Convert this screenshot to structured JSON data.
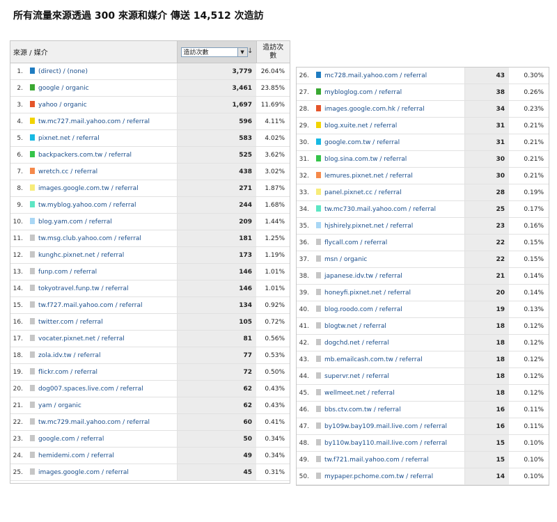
{
  "title": "所有流量來源透過 300 來源和媒介 傳送 14,512 次造訪",
  "table_header": {
    "source": "來源 / 媒介",
    "metric_select": "造訪次數",
    "metric_col": "造訪次數",
    "sort_icon": "sort-descending-icon",
    "dropdown_icon": "dropdown-arrow-icon"
  },
  "left_rows": [
    {
      "n": "1.",
      "src": "(direct) / (none)",
      "visits": "3,779",
      "pct": "26.04%",
      "color": "#1f7cc1"
    },
    {
      "n": "2.",
      "src": "google / organic",
      "visits": "3,461",
      "pct": "23.85%",
      "color": "#3aa832"
    },
    {
      "n": "3.",
      "src": "yahoo / organic",
      "visits": "1,697",
      "pct": "11.69%",
      "color": "#e4552b"
    },
    {
      "n": "4.",
      "src": "tw.mc727.mail.yahoo.com / referral",
      "visits": "596",
      "pct": "4.11%",
      "color": "#f2d400"
    },
    {
      "n": "5.",
      "src": "pixnet.net / referral",
      "visits": "583",
      "pct": "4.02%",
      "color": "#17b9e3"
    },
    {
      "n": "6.",
      "src": "backpackers.com.tw / referral",
      "visits": "525",
      "pct": "3.62%",
      "color": "#35c44a"
    },
    {
      "n": "7.",
      "src": "wretch.cc / referral",
      "visits": "438",
      "pct": "3.02%",
      "color": "#f5894a"
    },
    {
      "n": "8.",
      "src": "images.google.com.tw / referral",
      "visits": "271",
      "pct": "1.87%",
      "color": "#f7ec7a"
    },
    {
      "n": "9.",
      "src": "tw.myblog.yahoo.com / referral",
      "visits": "244",
      "pct": "1.68%",
      "color": "#5de6c4"
    },
    {
      "n": "10.",
      "src": "blog.yam.com / referral",
      "visits": "209",
      "pct": "1.44%",
      "color": "#a9d7f5"
    },
    {
      "n": "11.",
      "src": "tw.msg.club.yahoo.com / referral",
      "visits": "181",
      "pct": "1.25%",
      "color": "#c6c6c6"
    },
    {
      "n": "12.",
      "src": "kunghc.pixnet.net / referral",
      "visits": "173",
      "pct": "1.19%",
      "color": "#c6c6c6"
    },
    {
      "n": "13.",
      "src": "funp.com / referral",
      "visits": "146",
      "pct": "1.01%",
      "color": "#c6c6c6"
    },
    {
      "n": "14.",
      "src": "tokyotravel.funp.tw / referral",
      "visits": "146",
      "pct": "1.01%",
      "color": "#c6c6c6"
    },
    {
      "n": "15.",
      "src": "tw.f727.mail.yahoo.com / referral",
      "visits": "134",
      "pct": "0.92%",
      "color": "#c6c6c6"
    },
    {
      "n": "16.",
      "src": "twitter.com / referral",
      "visits": "105",
      "pct": "0.72%",
      "color": "#c6c6c6"
    },
    {
      "n": "17.",
      "src": "vocater.pixnet.net / referral",
      "visits": "81",
      "pct": "0.56%",
      "color": "#c6c6c6"
    },
    {
      "n": "18.",
      "src": "zola.idv.tw / referral",
      "visits": "77",
      "pct": "0.53%",
      "color": "#c6c6c6"
    },
    {
      "n": "19.",
      "src": "flickr.com / referral",
      "visits": "72",
      "pct": "0.50%",
      "color": "#c6c6c6"
    },
    {
      "n": "20.",
      "src": "dog007.spaces.live.com / referral",
      "visits": "62",
      "pct": "0.43%",
      "color": "#c6c6c6"
    },
    {
      "n": "21.",
      "src": "yam / organic",
      "visits": "62",
      "pct": "0.43%",
      "color": "#c6c6c6"
    },
    {
      "n": "22.",
      "src": "tw.mc729.mail.yahoo.com / referral",
      "visits": "60",
      "pct": "0.41%",
      "color": "#c6c6c6"
    },
    {
      "n": "23.",
      "src": "google.com / referral",
      "visits": "50",
      "pct": "0.34%",
      "color": "#c6c6c6"
    },
    {
      "n": "24.",
      "src": "hemidemi.com / referral",
      "visits": "49",
      "pct": "0.34%",
      "color": "#c6c6c6"
    },
    {
      "n": "25.",
      "src": "images.google.com / referral",
      "visits": "45",
      "pct": "0.31%",
      "color": "#c6c6c6"
    }
  ],
  "right_rows": [
    {
      "n": "26.",
      "src": "mc728.mail.yahoo.com / referral",
      "visits": "43",
      "pct": "0.30%",
      "color": "#1f7cc1"
    },
    {
      "n": "27.",
      "src": "mybloglog.com / referral",
      "visits": "38",
      "pct": "0.26%",
      "color": "#3aa832"
    },
    {
      "n": "28.",
      "src": "images.google.com.hk / referral",
      "visits": "34",
      "pct": "0.23%",
      "color": "#e4552b"
    },
    {
      "n": "29.",
      "src": "blog.xuite.net / referral",
      "visits": "31",
      "pct": "0.21%",
      "color": "#f2d400"
    },
    {
      "n": "30.",
      "src": "google.com.tw / referral",
      "visits": "31",
      "pct": "0.21%",
      "color": "#17b9e3"
    },
    {
      "n": "31.",
      "src": "blog.sina.com.tw / referral",
      "visits": "30",
      "pct": "0.21%",
      "color": "#35c44a"
    },
    {
      "n": "32.",
      "src": "lemures.pixnet.net / referral",
      "visits": "30",
      "pct": "0.21%",
      "color": "#f5894a"
    },
    {
      "n": "33.",
      "src": "panel.pixnet.cc / referral",
      "visits": "28",
      "pct": "0.19%",
      "color": "#f7ec7a"
    },
    {
      "n": "34.",
      "src": "tw.mc730.mail.yahoo.com / referral",
      "visits": "25",
      "pct": "0.17%",
      "color": "#5de6c4"
    },
    {
      "n": "35.",
      "src": "hjshirely.pixnet.net / referral",
      "visits": "23",
      "pct": "0.16%",
      "color": "#a9d7f5"
    },
    {
      "n": "36.",
      "src": "flycall.com / referral",
      "visits": "22",
      "pct": "0.15%",
      "color": "#c6c6c6"
    },
    {
      "n": "37.",
      "src": "msn / organic",
      "visits": "22",
      "pct": "0.15%",
      "color": "#c6c6c6"
    },
    {
      "n": "38.",
      "src": "japanese.idv.tw / referral",
      "visits": "21",
      "pct": "0.14%",
      "color": "#c6c6c6"
    },
    {
      "n": "39.",
      "src": "honeyfi.pixnet.net / referral",
      "visits": "20",
      "pct": "0.14%",
      "color": "#c6c6c6"
    },
    {
      "n": "40.",
      "src": "blog.roodo.com / referral",
      "visits": "19",
      "pct": "0.13%",
      "color": "#c6c6c6"
    },
    {
      "n": "41.",
      "src": "blogtw.net / referral",
      "visits": "18",
      "pct": "0.12%",
      "color": "#c6c6c6"
    },
    {
      "n": "42.",
      "src": "dogchd.net / referral",
      "visits": "18",
      "pct": "0.12%",
      "color": "#c6c6c6"
    },
    {
      "n": "43.",
      "src": "mb.emailcash.com.tw / referral",
      "visits": "18",
      "pct": "0.12%",
      "color": "#c6c6c6"
    },
    {
      "n": "44.",
      "src": "supervr.net / referral",
      "visits": "18",
      "pct": "0.12%",
      "color": "#c6c6c6"
    },
    {
      "n": "45.",
      "src": "wellmeet.net / referral",
      "visits": "18",
      "pct": "0.12%",
      "color": "#c6c6c6"
    },
    {
      "n": "46.",
      "src": "bbs.ctv.com.tw / referral",
      "visits": "16",
      "pct": "0.11%",
      "color": "#c6c6c6"
    },
    {
      "n": "47.",
      "src": "by109w.bay109.mail.live.com / referral",
      "visits": "16",
      "pct": "0.11%",
      "color": "#c6c6c6"
    },
    {
      "n": "48.",
      "src": "by110w.bay110.mail.live.com / referral",
      "visits": "15",
      "pct": "0.10%",
      "color": "#c6c6c6"
    },
    {
      "n": "49.",
      "src": "tw.f721.mail.yahoo.com / referral",
      "visits": "15",
      "pct": "0.10%",
      "color": "#c6c6c6"
    },
    {
      "n": "50.",
      "src": "mypaper.pchome.com.tw / referral",
      "visits": "14",
      "pct": "0.10%",
      "color": "#c6c6c6"
    }
  ]
}
